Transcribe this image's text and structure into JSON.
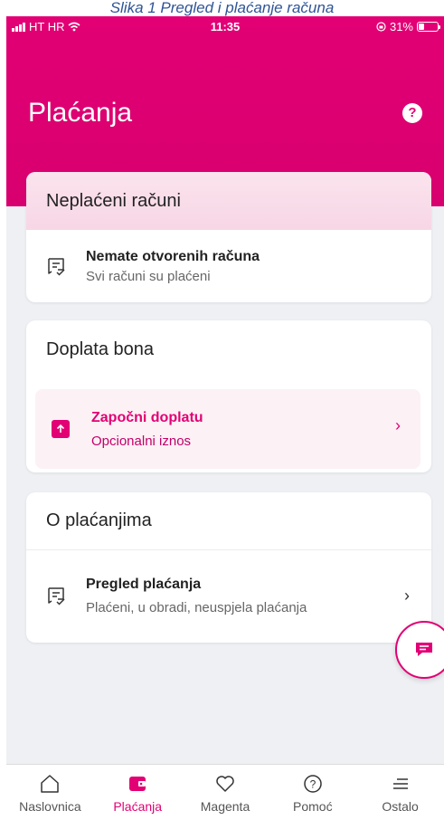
{
  "caption": "Slika 1 Pregled i plaćanje računa",
  "status": {
    "carrier": "HT HR",
    "time": "11:35",
    "battery": "31%"
  },
  "header": {
    "title": "Plaćanja"
  },
  "unpaid": {
    "title": "Neplaćeni računi",
    "item_title": "Nemate otvorenih računa",
    "item_sub": "Svi računi su plaćeni"
  },
  "topup": {
    "title": "Doplata bona",
    "item_title": "Započni doplatu",
    "item_sub": "Opcionalni iznos"
  },
  "about": {
    "title": "O plaćanjima",
    "item_title": "Pregled plaćanja",
    "item_sub": "Plaćeni, u obradi, neuspjela plaćanja"
  },
  "tabs": [
    {
      "label": "Naslovnica",
      "icon": "home-icon"
    },
    {
      "label": "Plaćanja",
      "icon": "wallet-icon",
      "active": true
    },
    {
      "label": "Magenta",
      "icon": "heart-icon"
    },
    {
      "label": "Pomoć",
      "icon": "help-icon"
    },
    {
      "label": "Ostalo",
      "icon": "menu-icon"
    }
  ],
  "colors": {
    "brand": "#e20074",
    "tint": "#fcf1f5"
  }
}
